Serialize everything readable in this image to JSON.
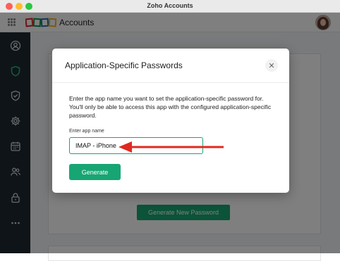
{
  "window": {
    "title": "Zoho Accounts"
  },
  "appbar": {
    "app_name": "Accounts"
  },
  "sidebar": {
    "items": [
      {
        "icon": "user-circle-icon"
      },
      {
        "icon": "shield-icon",
        "active": true
      },
      {
        "icon": "shield-check-icon"
      },
      {
        "icon": "gear-icon"
      },
      {
        "icon": "calendar-icon"
      },
      {
        "icon": "users-icon"
      },
      {
        "icon": "lock-icon"
      },
      {
        "icon": "more-icon"
      }
    ]
  },
  "background": {
    "generate_new_label": "Generate New Password"
  },
  "modal": {
    "title": "Application-Specific Passwords",
    "description": "Enter the app name you want to set the application-specific password for. You'll only be able to access this app with the configured application-specific password.",
    "field_label": "Enter app name",
    "input_value": "IMAP - iPhone",
    "generate_label": "Generate",
    "close_symbol": "✕"
  },
  "colors": {
    "accent": "#17a673",
    "sidebar": "#1f2830",
    "annotation_arrow": "#e0291f"
  }
}
